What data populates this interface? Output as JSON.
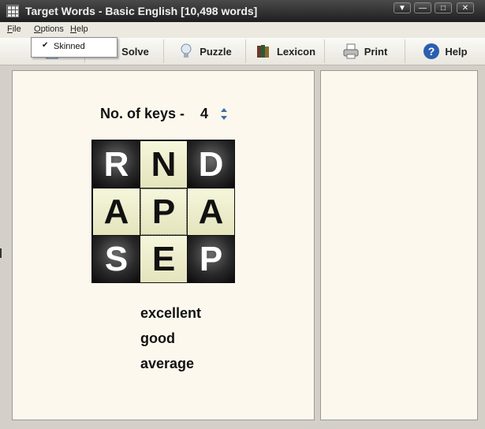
{
  "window": {
    "title": "Target Words - Basic English [10,498 words]",
    "buttons": [
      "▼",
      "—",
      "□",
      "✕"
    ]
  },
  "menu": [
    {
      "label": "File",
      "mnemonic": "F"
    },
    {
      "label": "Options",
      "mnemonic": "O"
    },
    {
      "label": "Help",
      "mnemonic": "H"
    }
  ],
  "options_dropdown": {
    "items": [
      {
        "label": "Skinned",
        "checked": true
      }
    ]
  },
  "toolbar": {
    "solve": "Solve",
    "puzzle": "Puzzle",
    "lexicon": "Lexicon",
    "print": "Print",
    "help": "Help"
  },
  "puzzle": {
    "keys_label": "No. of keys -",
    "keys_value": "4",
    "grid": [
      [
        "R",
        "N",
        "D"
      ],
      [
        "A",
        "P",
        "A"
      ],
      [
        "S",
        "E",
        "P"
      ]
    ],
    "cell_style": [
      [
        "dark",
        "light",
        "dark"
      ],
      [
        "light",
        "light",
        "light"
      ],
      [
        "dark",
        "light",
        "dark"
      ]
    ],
    "ratings": [
      "excellent",
      "good",
      "average"
    ]
  },
  "colors": {
    "panel_bg": "#fdf8ee",
    "titlebar": "#2b2b2b",
    "light_tile": "#eeeecb",
    "dark_tile": "#1a1a1a"
  }
}
